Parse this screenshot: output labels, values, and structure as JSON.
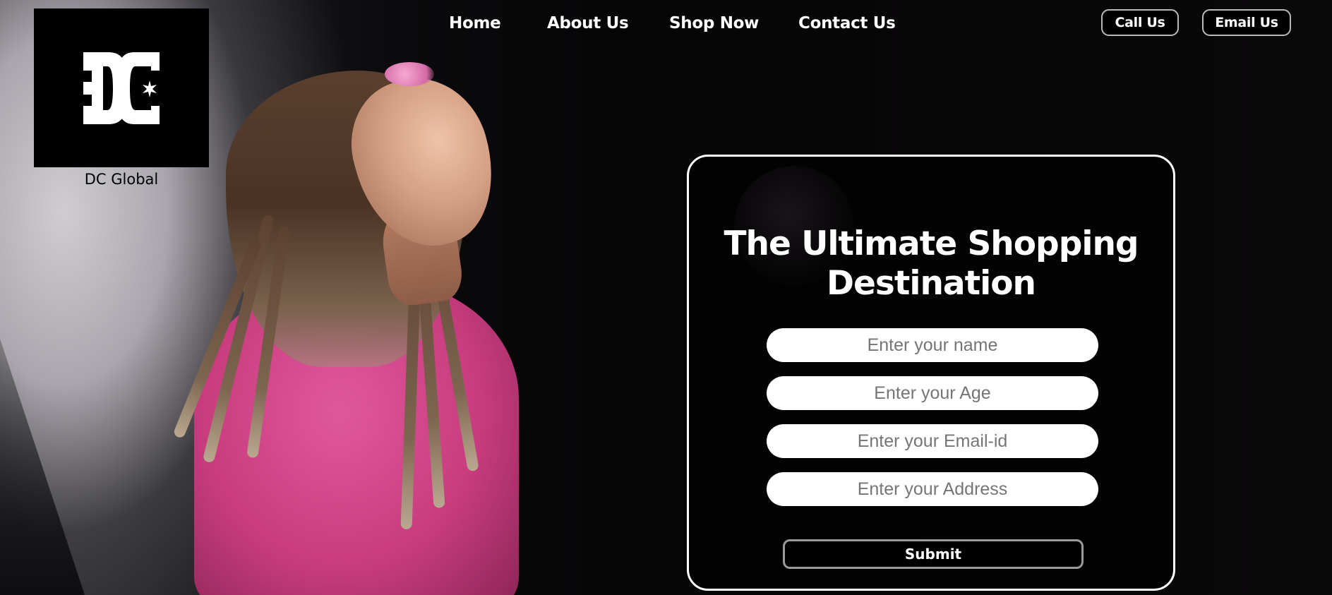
{
  "brand": {
    "name": "DC Global",
    "logo_icon": "dc-shoes-logo"
  },
  "nav": {
    "links": [
      "Home",
      "About Us",
      "Shop Now",
      "Contact Us"
    ]
  },
  "actions": {
    "call": "Call Us",
    "email": "Email Us"
  },
  "form": {
    "title_line1": "The Ultimate Shopping",
    "title_line2": "Destination",
    "fields": [
      {
        "placeholder": "Enter your name",
        "value": ""
      },
      {
        "placeholder": "Enter your Age",
        "value": ""
      },
      {
        "placeholder": "Enter your Email-id",
        "value": ""
      },
      {
        "placeholder": "Enter your Address",
        "value": ""
      }
    ],
    "submit_label": "Submit"
  },
  "colors": {
    "accent": "#ffffff",
    "background": "#070607",
    "shirt": "#d94a92"
  }
}
